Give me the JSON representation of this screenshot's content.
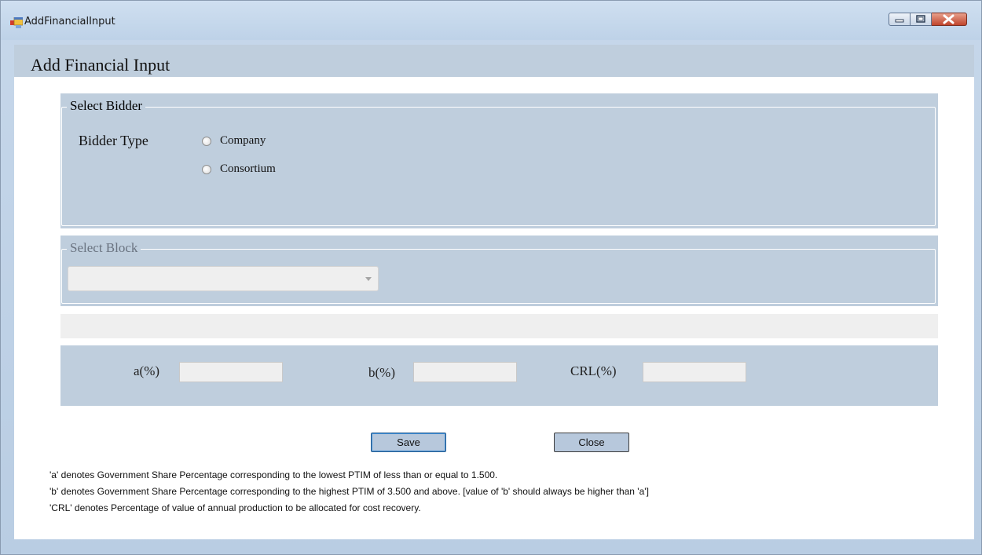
{
  "window": {
    "title": "AddFinancialInput",
    "accent_color": "#bfcedd"
  },
  "header": {
    "title": "Add Financial Input"
  },
  "select_bidder": {
    "legend": "Select Bidder",
    "bidder_type_label": "Bidder Type",
    "options": [
      {
        "label": "Company",
        "checked": false
      },
      {
        "label": "Consortium",
        "checked": false
      }
    ]
  },
  "select_block": {
    "legend": "Select Block",
    "selected_value": ""
  },
  "inputs": {
    "a_label": "a(%)",
    "a_value": "",
    "b_label": "b(%)",
    "b_value": "",
    "crl_label": "CRL(%)",
    "crl_value": ""
  },
  "actions": {
    "save_label": "Save",
    "close_label": "Close"
  },
  "notes": [
    "'a' denotes Government Share Percentage corresponding to the lowest PTIM of less than or equal to 1.500.",
    "'b' denotes Government Share Percentage corresponding to the highest PTIM of 3.500 and above. [value of 'b' should always be higher than 'a']",
    "'CRL' denotes Percentage of value of annual production to be allocated for cost recovery."
  ],
  "icons": {
    "app": "app-window-icon",
    "minimize": "minimize-icon",
    "maximize": "maximize-icon",
    "close": "close-icon",
    "dropdown": "chevron-down-icon"
  }
}
